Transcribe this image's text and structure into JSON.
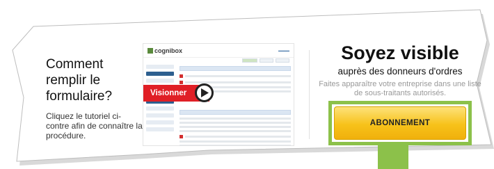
{
  "left_panel": {
    "heading": "Comment remplir le formulaire?",
    "instructions": "Cliquez le tutoriel ci-contre afin de connaître la procédure."
  },
  "video_thumbnail": {
    "logo_text": "cognibox",
    "play_label": "Visionner"
  },
  "right_panel": {
    "title": "Soyez visible",
    "subtitle": "auprès des donneurs d'ordres",
    "description": "Faites apparaître votre entreprise dans une liste de sous-traitants autorisés.",
    "cta_label": "ABONNEMENT"
  },
  "colors": {
    "accent_green": "#8cc14a",
    "button_yellow": "#f7c21a",
    "play_red": "#e01f26"
  }
}
